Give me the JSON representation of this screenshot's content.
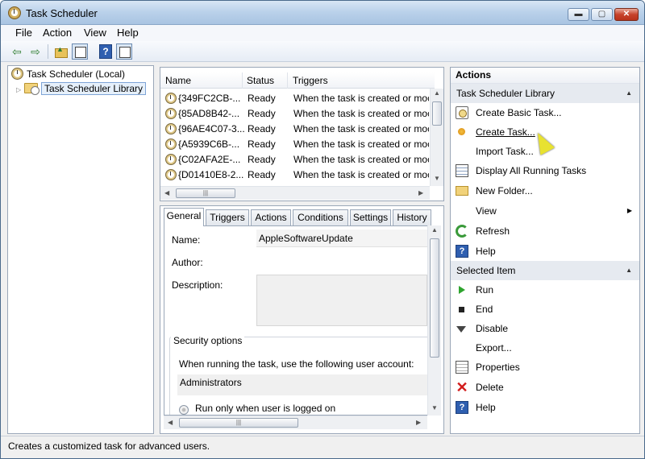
{
  "window": {
    "title": "Task Scheduler",
    "minimize": "▬",
    "maximize": "▢",
    "close": "✕"
  },
  "menu": {
    "file": "File",
    "action": "Action",
    "view": "View",
    "help": "Help"
  },
  "toolbar": {
    "back": "⇦",
    "forward": "⇨"
  },
  "tree": {
    "root": "Task Scheduler (Local)",
    "library": "Task Scheduler Library",
    "expander": "▷"
  },
  "task_list": {
    "columns": [
      "Name",
      "Status",
      "Triggers"
    ],
    "rows": [
      {
        "name": "{349FC2CB-...",
        "status": "Ready",
        "trigger": "When the task is created or moc"
      },
      {
        "name": "{85AD8B42-...",
        "status": "Ready",
        "trigger": "When the task is created or moc"
      },
      {
        "name": "{96AE4C07-3...",
        "status": "Ready",
        "trigger": "When the task is created or moc"
      },
      {
        "name": "{A5939C6B-...",
        "status": "Ready",
        "trigger": "When the task is created or moc"
      },
      {
        "name": "{C02AFA2E-...",
        "status": "Ready",
        "trigger": "When the task is created or moc"
      },
      {
        "name": "{D01410E8-2...",
        "status": "Ready",
        "trigger": "When the task is created or moc"
      }
    ]
  },
  "details": {
    "tabs": [
      "General",
      "Triggers",
      "Actions",
      "Conditions",
      "Settings",
      "History"
    ],
    "name_label": "Name:",
    "name_value": "AppleSoftwareUpdate",
    "author_label": "Author:",
    "description_label": "Description:",
    "security_title": "Security options",
    "security_text": "When running the task, use the following user account:",
    "account": "Administrators",
    "run_option": "Run only when user is logged on"
  },
  "actions": {
    "header": "Actions",
    "library_section": "Task Scheduler Library",
    "library_items": [
      {
        "label": "Create Basic Task...",
        "icon": "clock-box-icon"
      },
      {
        "label": "Create Task...",
        "icon": "sun-icon"
      },
      {
        "label": "Import Task...",
        "icon": ""
      },
      {
        "label": "Display All Running Tasks",
        "icon": "list-icon"
      },
      {
        "label": "New Folder...",
        "icon": "folder-icon"
      },
      {
        "label": "View",
        "icon": ""
      },
      {
        "label": "Refresh",
        "icon": "refresh-icon"
      },
      {
        "label": "Help",
        "icon": "help-icon"
      }
    ],
    "selected_section": "Selected Item",
    "selected_items": [
      {
        "label": "Run",
        "icon": "run-icon"
      },
      {
        "label": "End",
        "icon": "end-icon"
      },
      {
        "label": "Disable",
        "icon": "disable-icon"
      },
      {
        "label": "Export...",
        "icon": ""
      },
      {
        "label": "Properties",
        "icon": "properties-icon"
      },
      {
        "label": "Delete",
        "icon": "delete-icon"
      },
      {
        "label": "Help",
        "icon": "help-icon"
      }
    ]
  },
  "status_bar": {
    "text": "Creates a customized task for advanced users."
  },
  "colors": {
    "selection_border": "#7ea4d6",
    "section_bg": "#e6eaf0",
    "titlebar": "#b9d1ea"
  }
}
